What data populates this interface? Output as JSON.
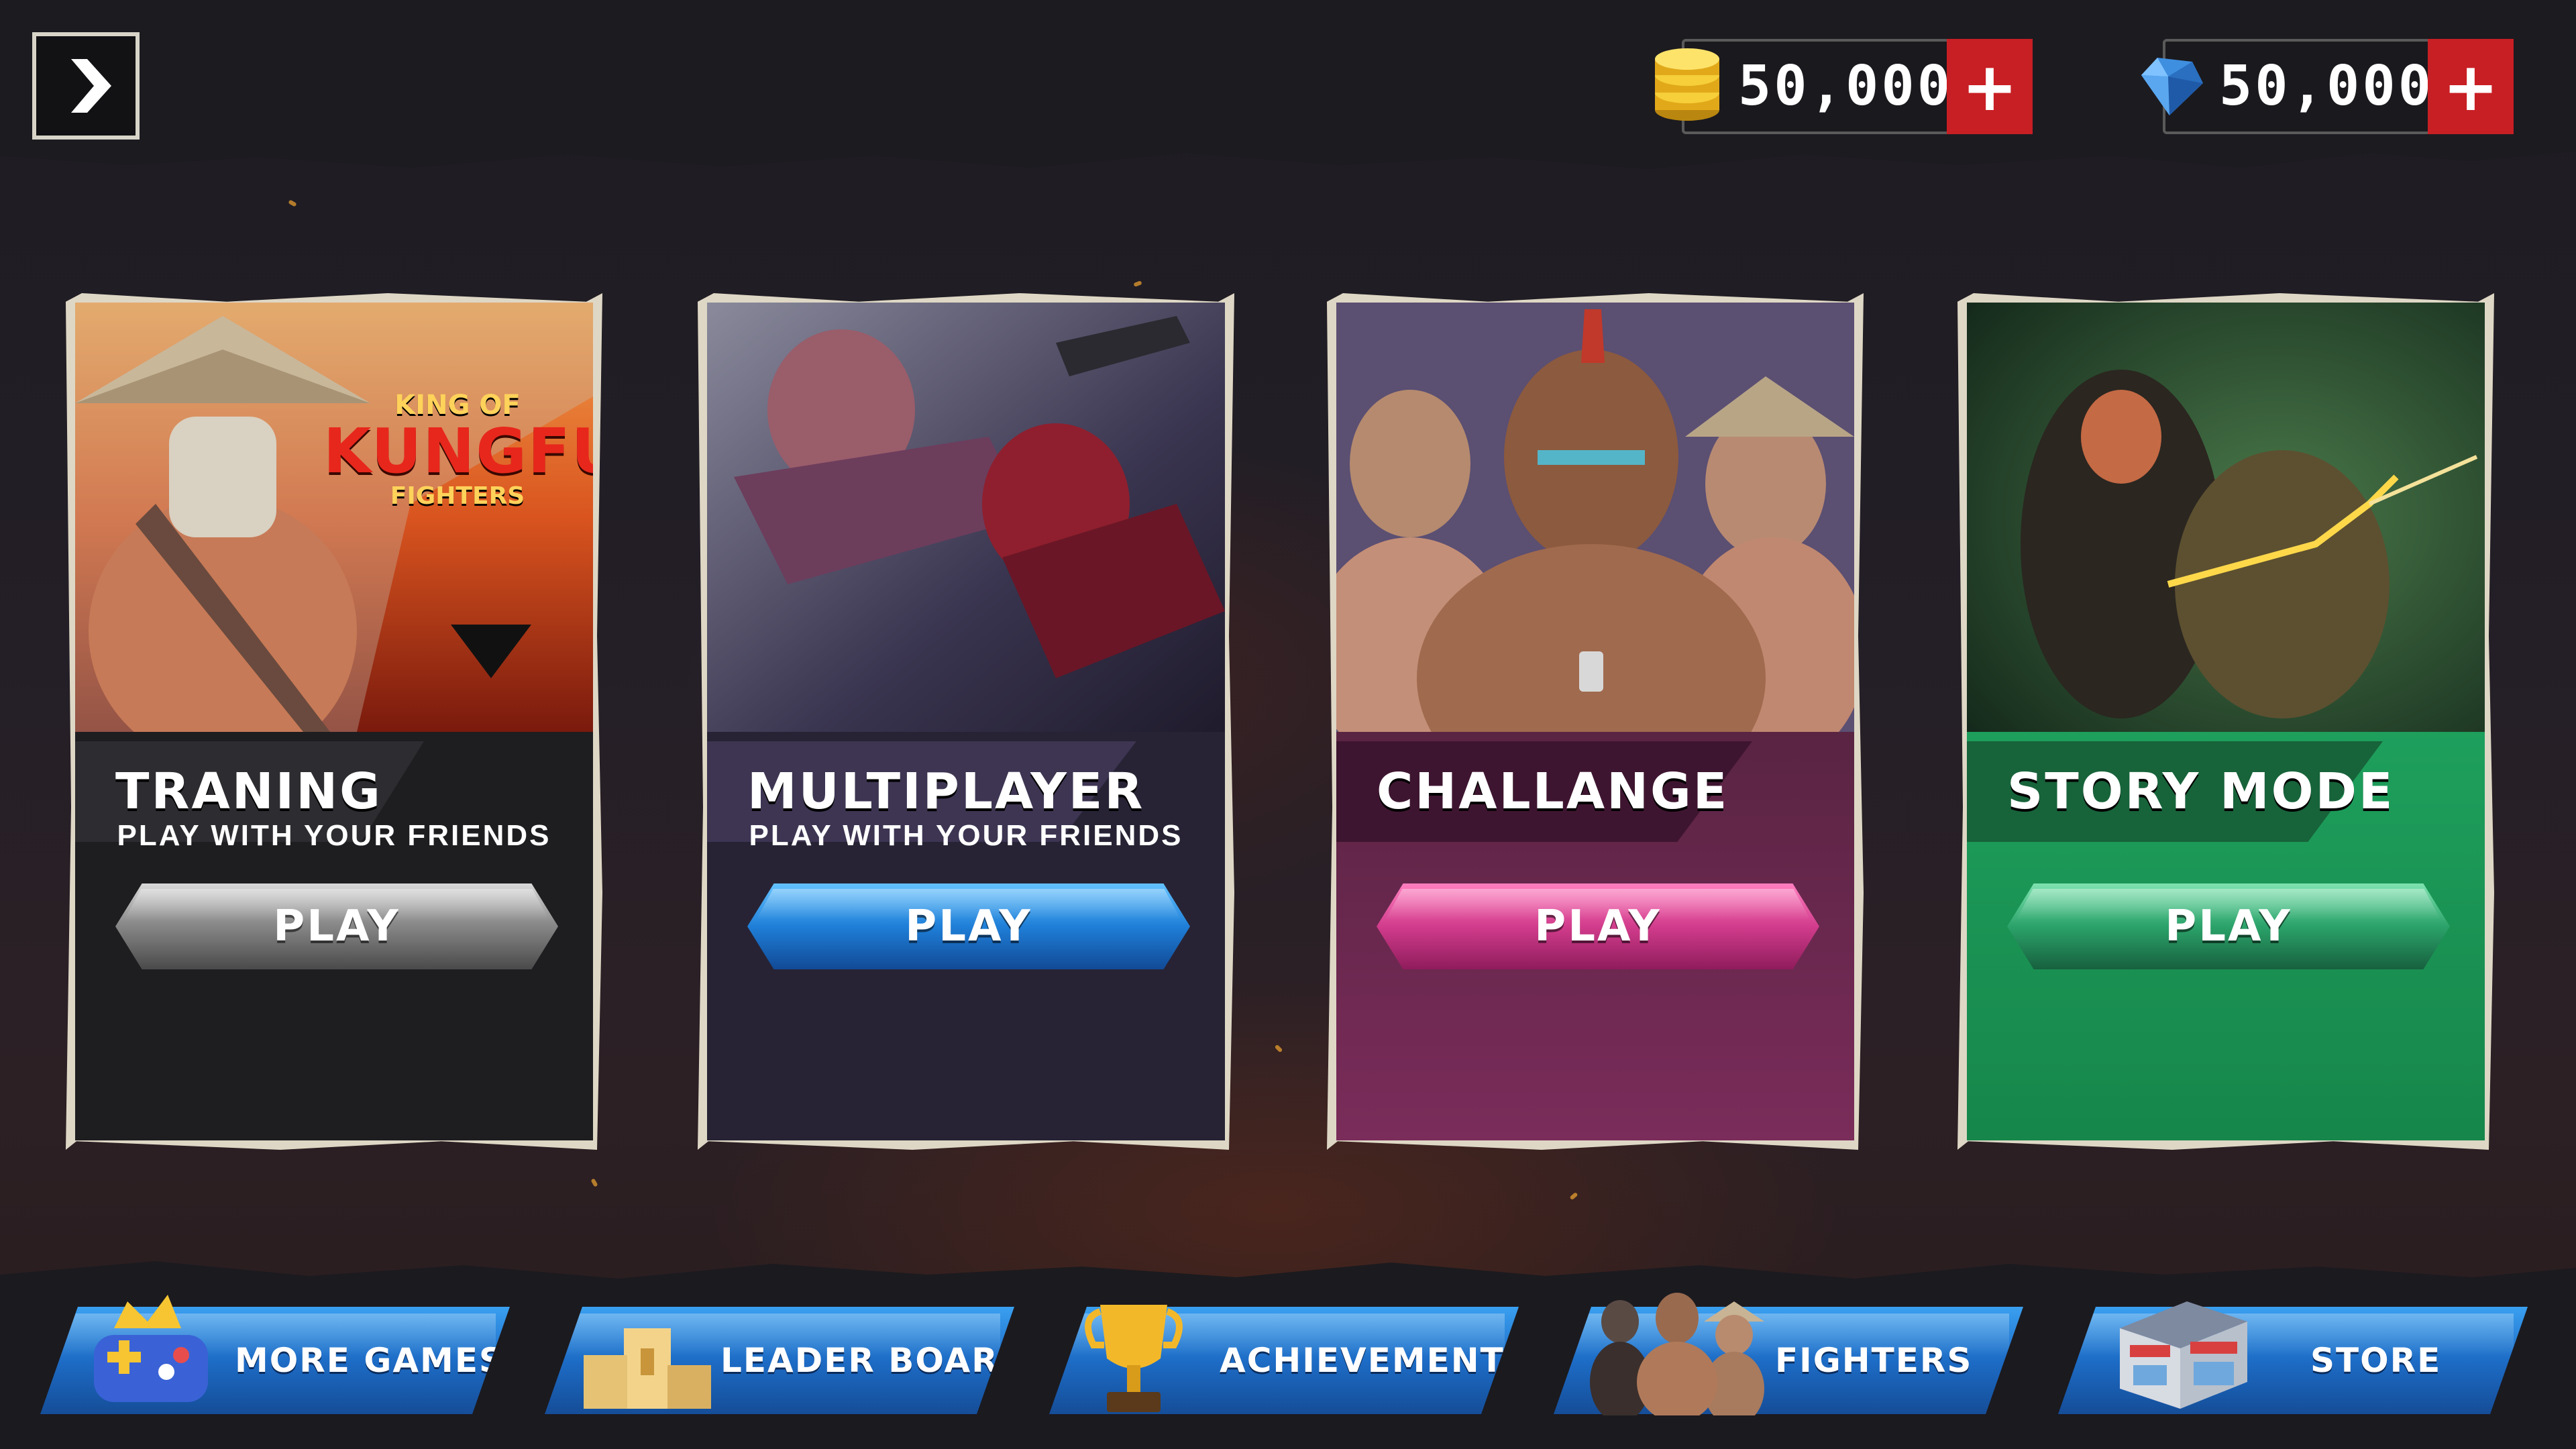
{
  "header": {
    "coins": {
      "value": "50,000",
      "add_label": "+"
    },
    "gems": {
      "value": "50,000",
      "add_label": "+"
    }
  },
  "modes": [
    {
      "title": "TRANING",
      "subtitle": "PLAY WITH YOUR FRIENDS",
      "play_label": "PLAY",
      "logo_lines": [
        "KING OF",
        "KUNGFU",
        "FIGHTERS"
      ],
      "accent": "#2a2a2a"
    },
    {
      "title": "MULTIPLAYER",
      "subtitle": "PLAY WITH YOUR FRIENDS",
      "play_label": "PLAY",
      "accent": "#3d3552"
    },
    {
      "title": "CHALLANGE",
      "subtitle": "",
      "play_label": "PLAY",
      "accent": "#5a2443"
    },
    {
      "title": "STORY MODE",
      "subtitle": "",
      "play_label": "PLAY",
      "accent": "#1a8a4e"
    }
  ],
  "nav": [
    {
      "label": "MORE GAMES",
      "icon": "gamepad-crown-icon"
    },
    {
      "label": "LEADER BOARD",
      "icon": "podium-icon"
    },
    {
      "label": "ACHIEVEMENTS",
      "icon": "trophy-icon"
    },
    {
      "label": "FIGHTERS",
      "icon": "fighters-group-icon"
    },
    {
      "label": "STORE",
      "icon": "store-building-icon"
    }
  ],
  "colors": {
    "accent_red": "#c81f24",
    "nav_blue": "#1d6cc6",
    "frame": "#ded7c5"
  }
}
